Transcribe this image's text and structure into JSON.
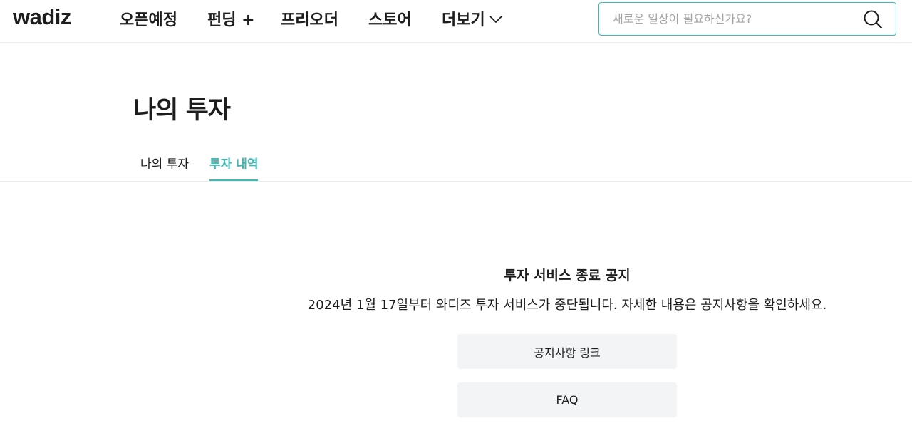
{
  "header": {
    "logo": "wadiz",
    "nav": [
      {
        "label": "오픈예정"
      },
      {
        "label": "펀딩 +"
      },
      {
        "label": "프리오더"
      },
      {
        "label": "스토어"
      },
      {
        "label": "더보기"
      }
    ],
    "search": {
      "placeholder": "새로운 일상이 필요하신가요?",
      "value": ""
    }
  },
  "page": {
    "title": "나의 투자",
    "tabs": [
      {
        "label": "나의 투자",
        "active": false
      },
      {
        "label": "투자 내역",
        "active": true
      }
    ]
  },
  "notice": {
    "title": "투자 서비스 종료 공지",
    "body": "2024년 1월 17일부터 와디즈 투자 서비스가 중단됩니다. 자세한 내용은 공지사항을 확인하세요.",
    "buttons": [
      {
        "label": "공지사항 링크"
      },
      {
        "label": "FAQ"
      }
    ]
  },
  "colors": {
    "accent": "#41b9b3",
    "text": "#1d1d1d",
    "button_bg": "#f3f4f6"
  },
  "icons": {
    "search": "search-icon",
    "more": "chevron-down-icon"
  }
}
